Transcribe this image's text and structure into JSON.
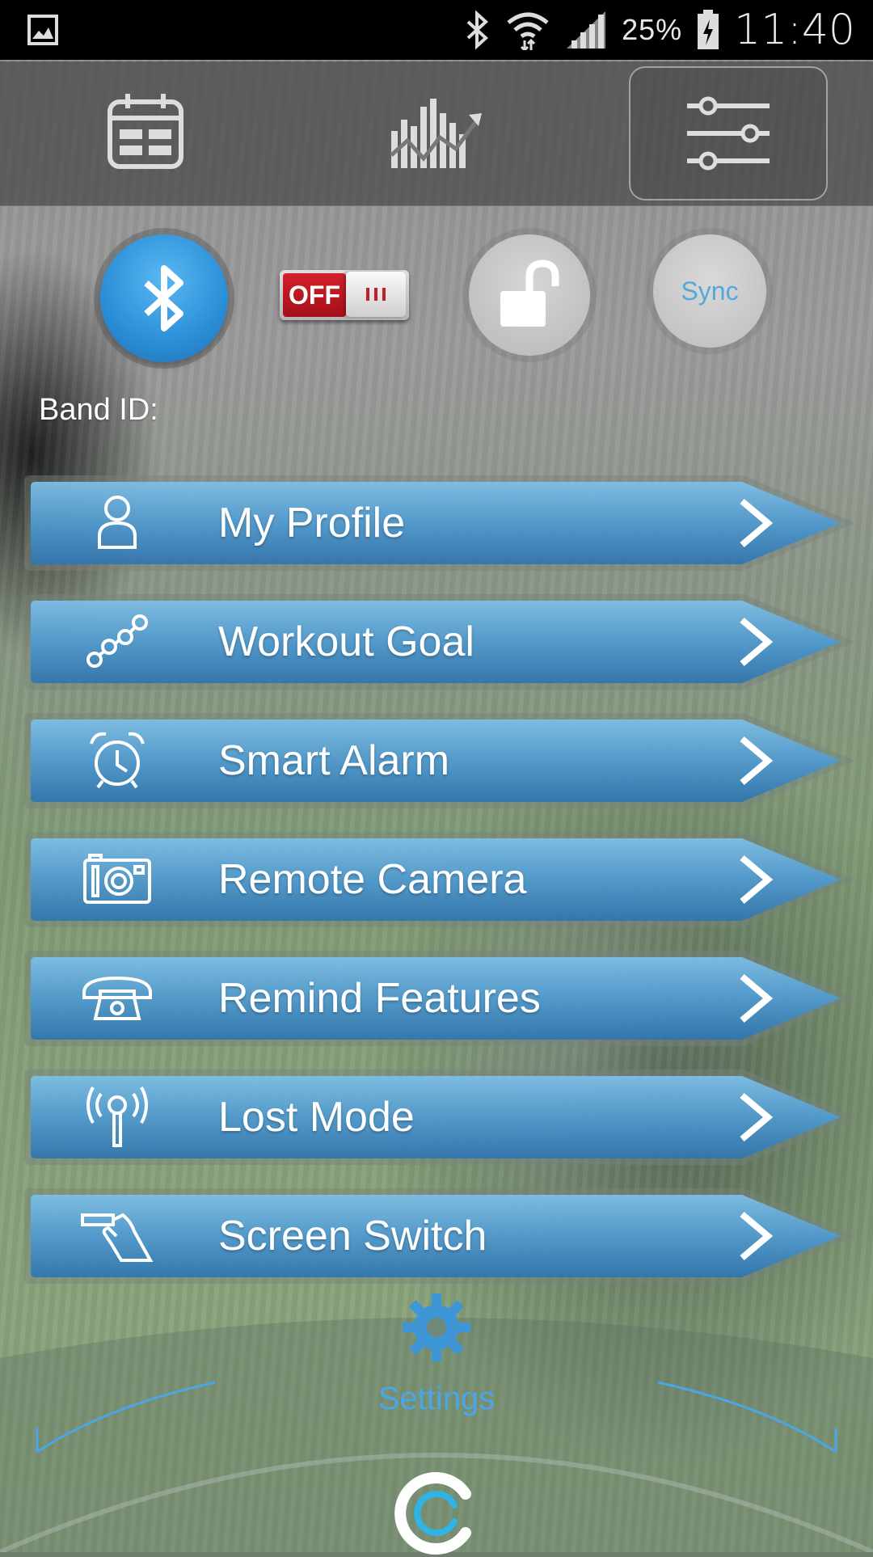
{
  "status_bar": {
    "battery_percent": "25%",
    "time": "11:40",
    "icons": [
      "gallery-icon",
      "bluetooth-icon",
      "wifi-icon",
      "signal-icon",
      "battery-icon"
    ]
  },
  "top_nav": {
    "tabs": [
      {
        "name": "calendar",
        "icon": "calendar-icon"
      },
      {
        "name": "statistics",
        "icon": "chart-icon"
      },
      {
        "name": "settings",
        "icon": "sliders-icon",
        "active": true
      }
    ]
  },
  "controls": {
    "bluetooth_icon": "bluetooth-icon",
    "toggle_label": "OFF",
    "lock_icon": "unlock-icon",
    "sync_label": "Sync"
  },
  "band_id_label": "Band ID:",
  "menu": {
    "items": [
      {
        "label": "My Profile",
        "icon": "person-icon"
      },
      {
        "label": "Workout Goal",
        "icon": "workout-path-icon"
      },
      {
        "label": "Smart Alarm",
        "icon": "alarm-clock-icon"
      },
      {
        "label": "Remote Camera",
        "icon": "camera-icon"
      },
      {
        "label": "Remind Features",
        "icon": "telephone-icon"
      },
      {
        "label": "Lost Mode",
        "icon": "antenna-icon"
      },
      {
        "label": "Screen Switch",
        "icon": "hand-tap-icon"
      }
    ]
  },
  "bottom": {
    "settings_label": "Settings",
    "colors": {
      "accent": "#4aa6e4",
      "menu_bar": "#4f9ad0"
    }
  }
}
